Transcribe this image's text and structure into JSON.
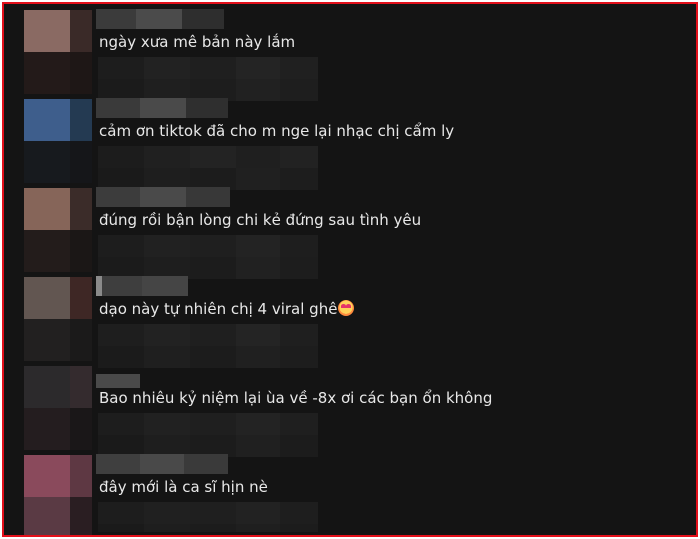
{
  "comments": [
    {
      "text": "ngày xưa mê bản này lắm",
      "avatar_colors": [
        "#8a6a63",
        "#3a2a28",
        "#231a19",
        "#1e1716"
      ]
    },
    {
      "text": "cảm ơn tiktok đã cho m nge lại nhạc chị cẩm ly",
      "avatar_colors": [
        "#3e5e8c",
        "#243a52",
        "#171a1e",
        "#151619"
      ]
    },
    {
      "text": "đúng rồi bận lòng chi kẻ đứng sau tình yêu",
      "avatar_colors": [
        "#866559",
        "#3b2c29",
        "#231c1b",
        "#1b1716"
      ]
    },
    {
      "text": "dạo này tự nhiên chị 4 viral ghê",
      "emoji": "smiling-face-with-hearts",
      "avatar_colors": [
        "#625651",
        "#3e2725",
        "#222020",
        "#1b1a1a"
      ]
    },
    {
      "text": "Bao nhiêu kỷ niệm lại ùa về -8x ơi các bạn ổn không",
      "avatar_colors": [
        "#2c2a2c",
        "#342b2e",
        "#241d1f",
        "#1a1718"
      ]
    },
    {
      "text": "đây mới là ca sĩ hịn nè",
      "avatar_colors": [
        "#8a4a5c",
        "#5e3843",
        "#5a3a44",
        "#2a1e22"
      ]
    }
  ]
}
